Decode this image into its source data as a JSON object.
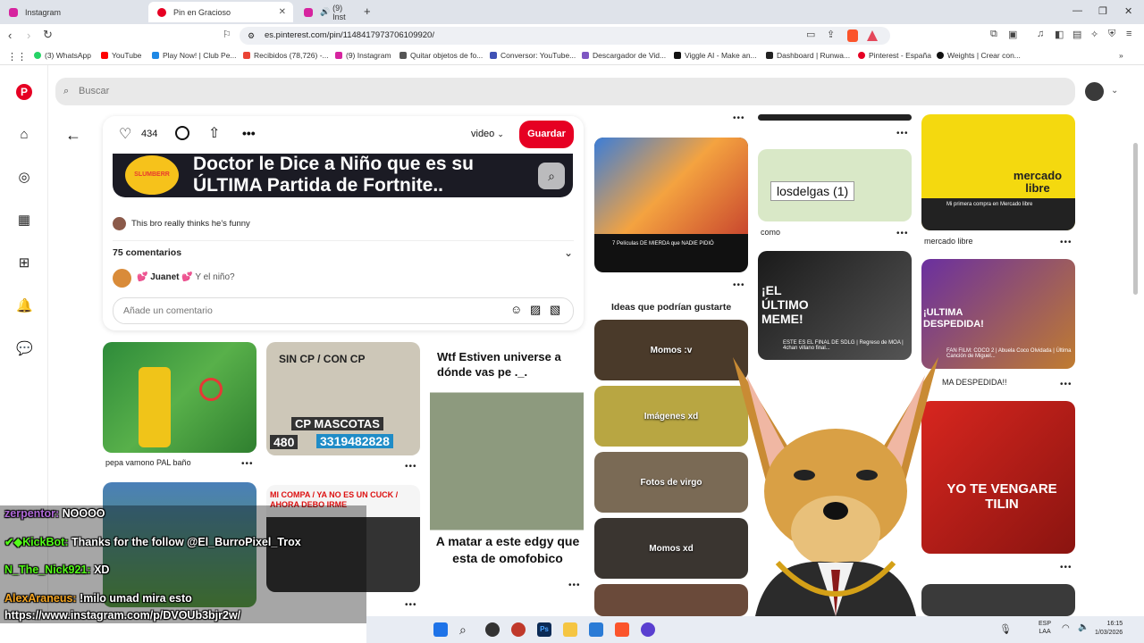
{
  "tabs": [
    {
      "label": "Instagram",
      "color": "#d6249f"
    },
    {
      "label": "Pin en Gracioso",
      "color": "#e60023"
    },
    {
      "label": "(9) Inst",
      "color": "#d6249f"
    }
  ],
  "url": "es.pinterest.com/pin/1148417973706109920/",
  "bookmarks": [
    {
      "label": "(3) WhatsApp",
      "color": "#25d366"
    },
    {
      "label": "YouTube",
      "color": "#ff0000"
    },
    {
      "label": "Play Now! | Club Pe...",
      "color": "#1e88e5"
    },
    {
      "label": "Recibidos (78,726) -...",
      "color": "#ea4335"
    },
    {
      "label": "(9) Instagram",
      "color": "#d6249f"
    },
    {
      "label": "Quitar objetos de fo...",
      "color": "#555555"
    },
    {
      "label": "Conversor: YouTube...",
      "color": "#3f51b5"
    },
    {
      "label": "Descargador de Vid...",
      "color": "#7e57c2"
    },
    {
      "label": "Viggle AI - Make an...",
      "color": "#111111"
    },
    {
      "label": "Dashboard | Runwa...",
      "color": "#222222"
    },
    {
      "label": "Pinterest - España",
      "color": "#e60023"
    },
    {
      "label": "Weights | Crear con...",
      "color": "#111111"
    }
  ],
  "search": {
    "placeholder": "Buscar"
  },
  "pin": {
    "likes": "434",
    "video_select": "video",
    "save_label": "Guardar",
    "video_title_line1": "Doctor le Dice a Niño que es su",
    "video_title_line2": "ÚLTIMA Partida de Fortnite..",
    "logo_text": "SLUMBERR",
    "description": "This bro really thinks he's funny",
    "comments_count": "75 comentarios",
    "comment_user": "Juanet",
    "comment_text": "Y el niño?",
    "add_comment_placeholder": "Añade un comentario"
  },
  "grid": {
    "pin1_label": "pepa vamono PAL baño",
    "pin2_text_top": "SIN CP / CON CP",
    "pin2_text_mid": "CP MASCOTAS",
    "pin2_phone": "3319482828",
    "pin2_num": "480",
    "pin3_top": "Wtf Estiven universe a dónde vas pe ._.",
    "pin3_bottom": "A matar a este edgy que esta de omofobico",
    "pin4_text": "MI COMPA / YA NO ES UN CUCK / AHORA DEBO IRME",
    "pin5_caption": "7 Películas DE MIERDA que NADIE PIDIÓ",
    "pin6_label": "como",
    "pin6_text": "losdelgas (1)",
    "pin7_text": "mercado libre",
    "pin7_title": "Mi primera compra en Mercado libre",
    "pin7_label": "mercado libre",
    "pin8_text": "¡EL ÚLTIMO MEME!",
    "pin8_caption": "ESTE ES EL FINAL DE SDLG | Regreso de MOA | 4chan villano final...",
    "pin9_text": "¡ULTIMA DESPEDIDA!",
    "pin9_caption": "FAN FILM: COCO 2 | Abuela Coco Olvidada | Última Canción de Miguel...",
    "pin9_label": "MA DESPEDIDA!!",
    "pin10_text": "YO TE VENGARE TILIN",
    "ideas_title": "Ideas que podrían gustarte",
    "boards": [
      "Momos :v",
      "Imágenes xd",
      "Fotos de virgo",
      "Momos xd"
    ]
  },
  "chat": [
    {
      "user": "zerpentor:",
      "text": "NOOOO",
      "user_color": "#b06ad8"
    },
    {
      "user": "KickBot:",
      "text": "Thanks for the follow @El_BurroPixel_Trox",
      "user_color": "#53fc18"
    },
    {
      "user": "N_The_Nick921:",
      "text": "XD",
      "user_color": "#53fc18"
    },
    {
      "user": "AlexAraneus:",
      "text": "!milo umad mira esto",
      "user_color": "#f5a623"
    }
  ],
  "chat_link": "https://www.instagram.com/p/DVOUb3bjr2w/",
  "taskbar": {
    "lang": "ESP",
    "lang2": "LAA",
    "time": "16:15",
    "date": "1/03/2026"
  }
}
